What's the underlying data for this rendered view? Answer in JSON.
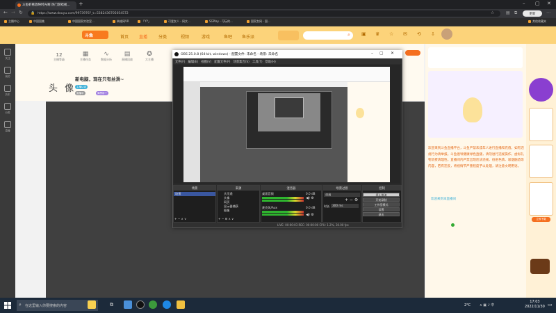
{
  "browser": {
    "tab_title": "斗鱼虾看放映时光啊 热门游戏视...",
    "url": "https://www.douyu.com/9973976?_t=5382436705054572",
    "bookmarks": [
      "主播中心",
      "中国国美",
      "中国国家实验室...",
      "映维网VR",
      "「YY」",
      "可爱女人 - 网文...",
      "SGPlay - 可玩的...",
      "国家女网 - 国...",
      "其他收藏夹"
    ],
    "avatar_label": "更新"
  },
  "site": {
    "logo": "斗鱼",
    "nav": [
      {
        "label": "首页",
        "active": false
      },
      {
        "label": "直播",
        "active": true
      },
      {
        "label": "分类",
        "active": false
      },
      {
        "label": "视频",
        "active": false
      },
      {
        "label": "游戏",
        "active": false
      },
      {
        "label": "鱼吧",
        "active": false
      },
      {
        "label": "鱼乐派",
        "active": false
      }
    ],
    "stats": [
      {
        "num": "12",
        "label": "主播等级"
      },
      {
        "num": "",
        "label": "主播任务"
      },
      {
        "num": "",
        "label": "数据分析"
      },
      {
        "num": "",
        "label": "直播回放"
      },
      {
        "num": "",
        "label": "大主播"
      }
    ],
    "room_title": "新电脑，现在只有丝滑~",
    "anchor_name": "头 像",
    "pills": [
      "主播认证",
      "直播中",
      "周榜前十"
    ],
    "left_rail": [
      "关注",
      "我的",
      "历史",
      "分类",
      "直播"
    ],
    "sidebar_paragraph": "欢迎来到斗鱼直播平台，斗鱼严禁未成年人进行直播和充值，如有违规行为请举报。斗鱼倡导健康绿色直播，请勿进行违规操作，虚拟礼物消费请理性。直播间内严禁出现违法违规、低俗色情、吸烟酗酒等内容，若有违反，将视情节严重程度予以处理，请注意文明用语。",
    "sidebar_foot": "欢迎来到本直播间",
    "ad_button": "立即下载"
  },
  "obs": {
    "title": "OBS 25.0.8 (64-bit, windows) - 配置文件: 未命名 - 场景: 未命名",
    "menu": [
      "文件(F)",
      "编辑(E)",
      "视图(V)",
      "配置文件(P)",
      "场景集合(S)",
      "工具(T)",
      "帮助(H)"
    ],
    "docks": {
      "scenes": {
        "title": "场景",
        "items": [
          "场景"
        ]
      },
      "sources": {
        "title": "来源",
        "items": [
          "大乐透",
          "头像",
          "网页",
          "显示器捕获",
          "图像"
        ]
      },
      "mixer": {
        "title": "混音器",
        "channels": [
          {
            "name": "桌面音频",
            "db": "0.0 dB"
          },
          {
            "name": "麦克风/Aux",
            "db": "0.0 dB"
          }
        ]
      },
      "transitions": {
        "title": "场景过渡",
        "type": "淡出",
        "duration_label": "时长",
        "duration": "300 ms"
      },
      "controls": {
        "title": "控制",
        "buttons": [
          {
            "label": "停止推流",
            "highlight": true
          },
          {
            "label": "开始录制",
            "highlight": false
          },
          {
            "label": "工作室模式",
            "highlight": false
          },
          {
            "label": "设置",
            "highlight": false
          },
          {
            "label": "退出",
            "highlight": false
          }
        ]
      }
    },
    "status": "LIVE: 00:00:03   REC: 00:00:00   CPU: 1.2%, 30.00 fps"
  },
  "taskbar": {
    "search_placeholder": "在这里输入你要搜索的内容",
    "weather": "2°C",
    "time": "17:03",
    "date": "2022/11/30"
  },
  "colors": {
    "accent": "#f56f1f",
    "site_header": "#fcd37a",
    "obs_bg": "#2b2b2b",
    "taskbar": "#1c2a3a"
  }
}
